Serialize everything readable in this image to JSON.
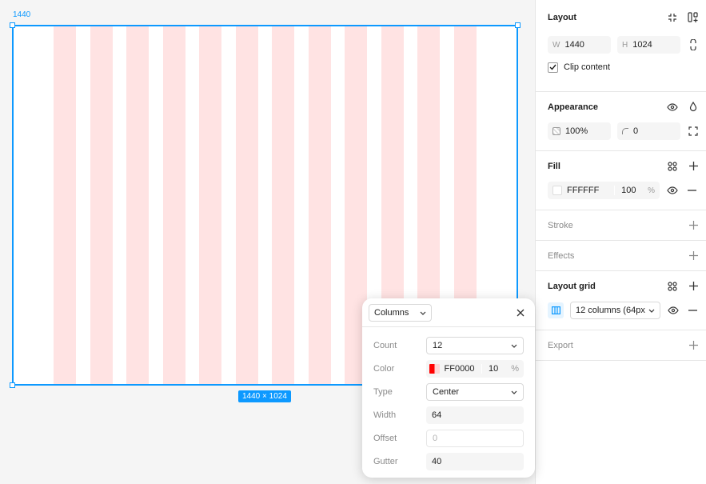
{
  "canvas": {
    "frame_label": "1440",
    "size_badge": "1440 × 1024",
    "grid_color": "#ffe3e3",
    "selection_color": "#0d99ff"
  },
  "panel": {
    "layout": {
      "title": "Layout",
      "width_prefix": "W",
      "width": "1440",
      "height_prefix": "H",
      "height": "1024",
      "clip_label": "Clip content",
      "clip_checked": true
    },
    "appearance": {
      "title": "Appearance",
      "opacity": "100%",
      "radius": "0"
    },
    "fill": {
      "title": "Fill",
      "hex": "FFFFFF",
      "opacity": "100",
      "percent": "%",
      "swatch": "#ffffff"
    },
    "stroke": {
      "title": "Stroke"
    },
    "effects": {
      "title": "Effects"
    },
    "layout_grid": {
      "title": "Layout grid",
      "grid_value": "12 columns (64px)"
    },
    "export": {
      "title": "Export"
    }
  },
  "popup": {
    "mode": "Columns",
    "count_label": "Count",
    "count": "12",
    "color_label": "Color",
    "color_hex": "FF0000",
    "color_opacity": "10",
    "color_percent": "%",
    "color_swatch": "#ff0000",
    "type_label": "Type",
    "type": "Center",
    "width_label": "Width",
    "width": "64",
    "offset_label": "Offset",
    "offset_placeholder": "0",
    "gutter_label": "Gutter",
    "gutter": "40"
  }
}
